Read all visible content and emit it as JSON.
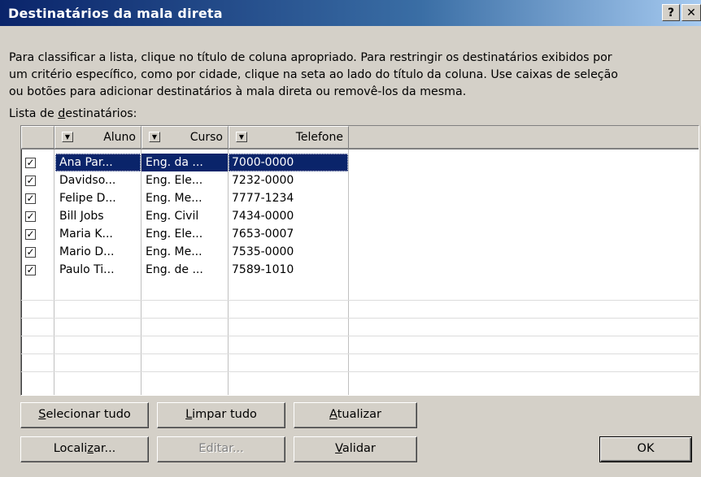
{
  "window": {
    "title": "Destinatários da mala direta",
    "help_label": "?",
    "close_label": "✕"
  },
  "instructions": {
    "line1": "Para classificar a lista, clique no título de coluna apropriado. Para restringir os destinatários exibidos por",
    "line2": "um critério específico, como por cidade, clique na seta ao lado do título da coluna. Use caixas de seleção",
    "line3": "ou botões para adicionar destinatários à mala direta ou removê-los da mesma."
  },
  "list_label": {
    "pre": "Lista de ",
    "accel": "d",
    "post": "estinatários:"
  },
  "columns": {
    "aluno": "Aluno",
    "curso": "Curso",
    "telefone": "Telefone",
    "dropdown_glyph": "▼"
  },
  "rows": [
    {
      "checked": "✓",
      "aluno": "Ana Par...",
      "curso": "Eng. da ...",
      "telefone": "7000-0000"
    },
    {
      "checked": "✓",
      "aluno": "Davidso...",
      "curso": "Eng. Ele...",
      "telefone": "7232-0000"
    },
    {
      "checked": "✓",
      "aluno": "Felipe D...",
      "curso": "Eng. Me...",
      "telefone": "7777-1234"
    },
    {
      "checked": "✓",
      "aluno": "Bill Jobs",
      "curso": "Eng. Civil",
      "telefone": "7434-0000"
    },
    {
      "checked": "✓",
      "aluno": "Maria K...",
      "curso": "Eng. Ele...",
      "telefone": "7653-0007"
    },
    {
      "checked": "✓",
      "aluno": "Mario D...",
      "curso": "Eng. Me...",
      "telefone": "7535-0000"
    },
    {
      "checked": "✓",
      "aluno": "Paulo Ti...",
      "curso": "Eng. de ...",
      "telefone": "7589-1010"
    }
  ],
  "buttons": {
    "selecionar": {
      "accel": "S",
      "rest": "elecionar tudo"
    },
    "limpar": {
      "accel": "L",
      "rest": "impar tudo"
    },
    "atualizar": {
      "accel": "A",
      "rest": "tualizar"
    },
    "localizar": {
      "pre": "Locali",
      "accel": "z",
      "post": "ar..."
    },
    "editar": {
      "label": "Editar..."
    },
    "validar": {
      "accel": "V",
      "rest": "alidar"
    },
    "ok": {
      "label": "OK"
    }
  }
}
